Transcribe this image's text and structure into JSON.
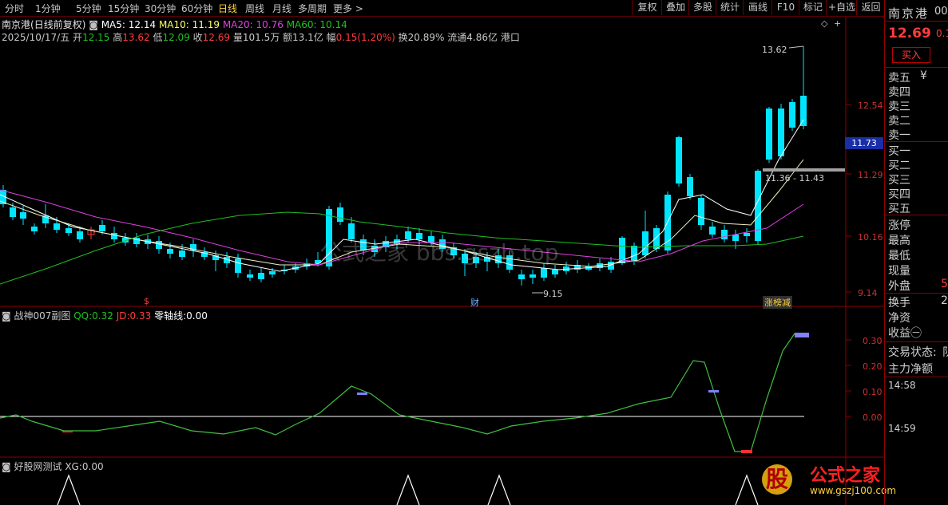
{
  "periods": [
    {
      "label": "分时",
      "active": false
    },
    {
      "label": "1分钟",
      "active": false
    },
    {
      "label": "5分钟",
      "active": false
    },
    {
      "label": "15分钟",
      "active": false
    },
    {
      "label": "30分钟",
      "active": false
    },
    {
      "label": "60分钟",
      "active": false
    },
    {
      "label": "日线",
      "active": true
    },
    {
      "label": "周线",
      "active": false
    },
    {
      "label": "月线",
      "active": false
    },
    {
      "label": "多周期",
      "active": false
    },
    {
      "label": "更多 >",
      "active": false
    }
  ],
  "toolbar": [
    "复权",
    "叠加",
    "多股",
    "统计",
    "画线",
    "F10",
    "标记",
    "+自选",
    "返回"
  ],
  "stock": {
    "name": "南京港",
    "mode": "(日线前复权)",
    "date": "2025/10/17/五"
  },
  "ma": {
    "ma5": "MA5: 12.14",
    "ma10": "MA10: 11.19",
    "ma20": "MA20: 10.76",
    "ma60": "MA60: 10.14"
  },
  "quote": {
    "open_label": "开",
    "open": "12.15",
    "high_label": "高",
    "high": "13.62",
    "low_label": "低",
    "low": "12.09",
    "close_label": "收",
    "close": "12.69",
    "vol": "量101.5万",
    "amount": "额13.1亿",
    "change_label": "幅",
    "change": "0.15(1.20%)",
    "turnover": "换20.89%",
    "float": "流通4.86亿",
    "board": "港口"
  },
  "price_axis": [
    "12.54",
    "11.29",
    "10.16",
    "9.14"
  ],
  "current_price_tag": "11.73",
  "annotations": {
    "high": "13.62",
    "low": "9.15",
    "range": "11.36 - 11.43",
    "cai": "财",
    "s_mark": "$",
    "zb": "涨榜减"
  },
  "sub1": {
    "title": "战神007副图",
    "qq_label": "QQ:",
    "qq": "0.32",
    "jd_label": "JD:",
    "jd": "0.33",
    "zero_label": "零轴线:",
    "zero": "0.00",
    "axis": [
      "0.30",
      "0.20",
      "0.10",
      "0.00"
    ]
  },
  "sub2": {
    "title": "好股网测试",
    "xg_label": "XG:",
    "xg": "0.00"
  },
  "side": {
    "name": "南京港",
    "code": "00",
    "price": "12.69",
    "pct": "0.1",
    "buy_btn": "买入",
    "rows": [
      "卖五",
      "卖四",
      "卖三",
      "卖二",
      "卖一",
      "买一",
      "买二",
      "买三",
      "买四",
      "买五",
      "涨停",
      "最高",
      "最低",
      "现量",
      "外盘",
      "换手",
      "净资",
      "收益㊀",
      "交易状态:",
      "主力净额"
    ],
    "sell5_extra": "¥",
    "waipan_val": "5",
    "huanshou_val": "2",
    "status_val": "队",
    "time1": "14:58",
    "time2": "14:59"
  },
  "watermark": {
    "text": "公式之家",
    "site": "www.gszj100.com",
    "center": "公式之家 bbs.gszb.top"
  },
  "logo": {
    "char": "股",
    "brand": "公式之家",
    "url": "www.gszj100.com"
  },
  "colors": {
    "up": "#ff3c3c",
    "down": "#00e5ff",
    "ma5": "#ffffff",
    "ma10": "#ffff66",
    "ma20": "#e040e0",
    "ma60": "#20c020",
    "axis": "#8b0000"
  }
}
